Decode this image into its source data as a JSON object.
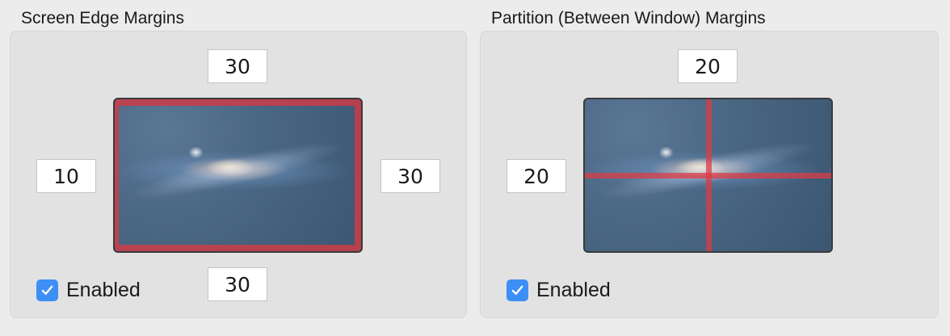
{
  "screen_edge": {
    "title": "Screen Edge Margins",
    "top": "30",
    "left": "10",
    "right": "30",
    "bottom": "30",
    "enabled_label": "Enabled",
    "enabled": true
  },
  "partition": {
    "title": "Partition (Between Window) Margins",
    "horizontal": "20",
    "vertical": "20",
    "enabled_label": "Enabled",
    "enabled": true
  },
  "colors": {
    "accent": "#3d8ff5",
    "margin_highlight": "#cd3c46"
  },
  "icons": {
    "checkbox": "checkmark-icon",
    "preview": "galaxy-wallpaper"
  }
}
